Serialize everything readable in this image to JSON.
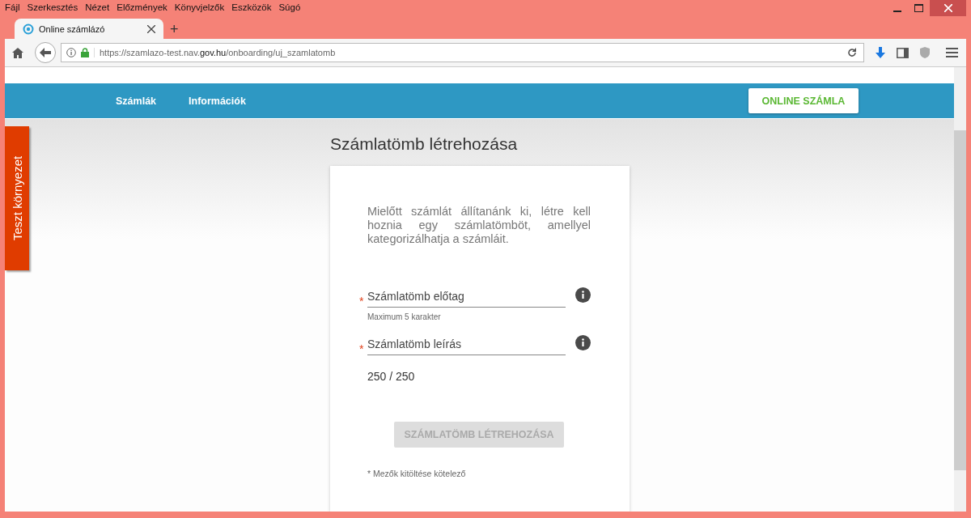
{
  "browser": {
    "menu": [
      "Fájl",
      "Szerkesztés",
      "Nézet",
      "Előzmények",
      "Könyvjelzők",
      "Eszközök",
      "Súgó"
    ],
    "tabs": [
      {
        "title": "Online számlázó",
        "selected": true
      }
    ],
    "new_tab": "+",
    "address": {
      "prefix": "https://szamlazo-test.nav.",
      "domain": "gov.hu",
      "path": "/onboarding/uj_szamlatomb"
    }
  },
  "page": {
    "nav": [
      {
        "label": "Számlák"
      },
      {
        "label": "Információk"
      }
    ],
    "nav_button": "ONLINE SZÁMLA",
    "env_tab": "Teszt környezet",
    "title": "Számlatömb létrehozása",
    "intro": "Mielőtt számlát állítanánk ki, létre kell hoznia egy számlatömböt, amellyel kategorizálhatja a számláit.",
    "fields": [
      {
        "marker": "*",
        "placeholder": "Számlatömb előtag",
        "hint": "Maximum 5 karakter"
      },
      {
        "marker": "*",
        "placeholder": "Számlatömb leírás",
        "counter": "250 / 250"
      }
    ],
    "submit": {
      "label": "SZÁMLATÖMB LÉTREHOZÁSA",
      "disabled": true
    },
    "footnote": "* Mezők kitöltése kötelező"
  }
}
